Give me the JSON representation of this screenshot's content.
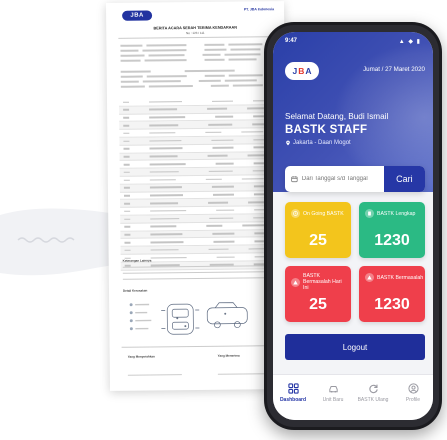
{
  "document": {
    "logo_text": "JBA",
    "company_name": "PT. JBA Indonesia",
    "company_lines": [
      "",
      "",
      ""
    ],
    "title": "BERITA ACARA SERAH TERIMA KENDARAAN",
    "doc_no": "No : 123 / 111",
    "section_remarks": "Keterangan Lainnya",
    "section_damage": "Detail Kerusakan",
    "legend": [
      "",
      "",
      "",
      ""
    ],
    "sign_left": "Yang Menyerahkan",
    "sign_right": "Yang Menerima"
  },
  "phone": {
    "status_time": "9:47",
    "status_icons": "▲ ◆ ▮",
    "logo": {
      "left": "J",
      "mid": "B",
      "right": "A"
    },
    "date": "Jumat / 27 Maret 2020",
    "welcome": "Selamat Datang, Budi Ismail",
    "role": "BASTK STAFF",
    "location": "Jakarta - Daan Mogot",
    "search": {
      "placeholder": "Dari Tanggal s/d Tanggal",
      "button": "Cari"
    },
    "cards": [
      {
        "label": "On Going BASTK",
        "value": "25",
        "color": "#f3c51c"
      },
      {
        "label": "BASTK Lengkap",
        "value": "1230",
        "color": "#2bba84"
      },
      {
        "label": "BASTK Bermasalah Hari Ini",
        "value": "25",
        "color": "#ef3f4b"
      },
      {
        "label": "BASTK Bermasalah",
        "value": "1230",
        "color": "#ef3f4b"
      }
    ],
    "logout": "Logout",
    "nav": [
      {
        "label": "Dashboard",
        "icon": "grid-icon",
        "active": true
      },
      {
        "label": "Unit Baru",
        "icon": "car-icon",
        "active": false
      },
      {
        "label": "BASTK Ulang",
        "icon": "refresh-icon",
        "active": false
      },
      {
        "label": "Profile",
        "icon": "user-icon",
        "active": false
      }
    ],
    "accent": "#2637a6"
  }
}
